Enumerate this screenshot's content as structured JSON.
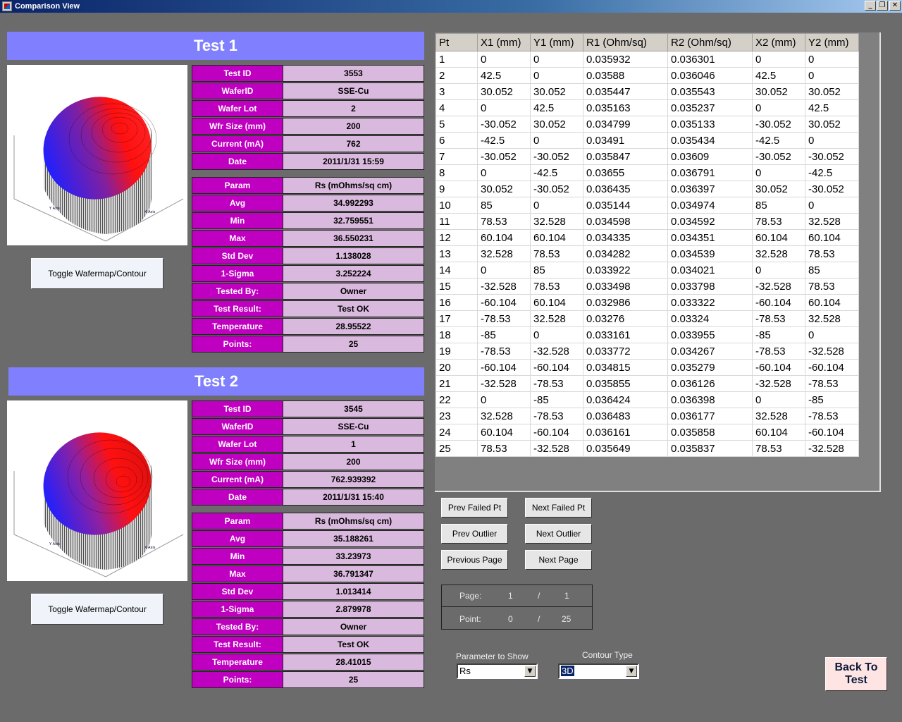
{
  "window": {
    "title": "Comparison View"
  },
  "test1": {
    "header": "Test 1",
    "toggle_label": "Toggle Wafermap/Contour",
    "info": [
      {
        "key": "Test ID",
        "value": "3553"
      },
      {
        "key": "WaferID",
        "value": "SSE-Cu"
      },
      {
        "key": "Wafer Lot",
        "value": "2"
      },
      {
        "key": "Wfr Size (mm)",
        "value": "200"
      },
      {
        "key": "Current (mA)",
        "value": "762"
      },
      {
        "key": "Date",
        "value": "2011/1/31 15:59"
      }
    ],
    "stats": [
      {
        "key": "Param",
        "value": "Rs (mOhms/sq cm)"
      },
      {
        "key": "Avg",
        "value": "34.992293"
      },
      {
        "key": "Min",
        "value": "32.759551"
      },
      {
        "key": "Max",
        "value": "36.550231"
      },
      {
        "key": "Std Dev",
        "value": "1.138028"
      },
      {
        "key": "1-Sigma",
        "value": "3.252224"
      },
      {
        "key": "Tested By:",
        "value": "Owner"
      },
      {
        "key": "Test Result:",
        "value": "Test OK"
      },
      {
        "key": "Temperature",
        "value": "28.95522"
      },
      {
        "key": "Points:",
        "value": "25"
      }
    ]
  },
  "test2": {
    "header": "Test 2",
    "toggle_label": "Toggle Wafermap/Contour",
    "info": [
      {
        "key": "Test ID",
        "value": "3545"
      },
      {
        "key": "WaferID",
        "value": "SSE-Cu"
      },
      {
        "key": "Wafer Lot",
        "value": "1"
      },
      {
        "key": "Wfr Size (mm)",
        "value": "200"
      },
      {
        "key": "Current (mA)",
        "value": "762.939392"
      },
      {
        "key": "Date",
        "value": "2011/1/31 15:40"
      }
    ],
    "stats": [
      {
        "key": "Param",
        "value": "Rs (mOhms/sq cm)"
      },
      {
        "key": "Avg",
        "value": "35.188261"
      },
      {
        "key": "Min",
        "value": "33.23973"
      },
      {
        "key": "Max",
        "value": "36.791347"
      },
      {
        "key": "Std Dev",
        "value": "1.013414"
      },
      {
        "key": "1-Sigma",
        "value": "2.879978"
      },
      {
        "key": "Tested By:",
        "value": "Owner"
      },
      {
        "key": "Test Result:",
        "value": "Test OK"
      },
      {
        "key": "Temperature",
        "value": "28.41015"
      },
      {
        "key": "Points:",
        "value": "25"
      }
    ]
  },
  "grid": {
    "columns": [
      "Pt",
      "X1 (mm)",
      "Y1 (mm)",
      "R1 (Ohm/sq)",
      "R2 (Ohm/sq)",
      "X2 (mm)",
      "Y2 (mm)"
    ],
    "rows": [
      [
        "1",
        "0",
        "0",
        "0.035932",
        "0.036301",
        "0",
        "0"
      ],
      [
        "2",
        "42.5",
        "0",
        "0.03588",
        "0.036046",
        "42.5",
        "0"
      ],
      [
        "3",
        "30.052",
        "30.052",
        "0.035447",
        "0.035543",
        "30.052",
        "30.052"
      ],
      [
        "4",
        "0",
        "42.5",
        "0.035163",
        "0.035237",
        "0",
        "42.5"
      ],
      [
        "5",
        "-30.052",
        "30.052",
        "0.034799",
        "0.035133",
        "-30.052",
        "30.052"
      ],
      [
        "6",
        "-42.5",
        "0",
        "0.03491",
        "0.035434",
        "-42.5",
        "0"
      ],
      [
        "7",
        "-30.052",
        "-30.052",
        "0.035847",
        "0.03609",
        "-30.052",
        "-30.052"
      ],
      [
        "8",
        "0",
        "-42.5",
        "0.03655",
        "0.036791",
        "0",
        "-42.5"
      ],
      [
        "9",
        "30.052",
        "-30.052",
        "0.036435",
        "0.036397",
        "30.052",
        "-30.052"
      ],
      [
        "10",
        "85",
        "0",
        "0.035144",
        "0.034974",
        "85",
        "0"
      ],
      [
        "11",
        "78.53",
        "32.528",
        "0.034598",
        "0.034592",
        "78.53",
        "32.528"
      ],
      [
        "12",
        "60.104",
        "60.104",
        "0.034335",
        "0.034351",
        "60.104",
        "60.104"
      ],
      [
        "13",
        "32.528",
        "78.53",
        "0.034282",
        "0.034539",
        "32.528",
        "78.53"
      ],
      [
        "14",
        "0",
        "85",
        "0.033922",
        "0.034021",
        "0",
        "85"
      ],
      [
        "15",
        "-32.528",
        "78.53",
        "0.033498",
        "0.033798",
        "-32.528",
        "78.53"
      ],
      [
        "16",
        "-60.104",
        "60.104",
        "0.032986",
        "0.033322",
        "-60.104",
        "60.104"
      ],
      [
        "17",
        "-78.53",
        "32.528",
        "0.03276",
        "0.03324",
        "-78.53",
        "32.528"
      ],
      [
        "18",
        "-85",
        "0",
        "0.033161",
        "0.033955",
        "-85",
        "0"
      ],
      [
        "19",
        "-78.53",
        "-32.528",
        "0.033772",
        "0.034267",
        "-78.53",
        "-32.528"
      ],
      [
        "20",
        "-60.104",
        "-60.104",
        "0.034815",
        "0.035279",
        "-60.104",
        "-60.104"
      ],
      [
        "21",
        "-32.528",
        "-78.53",
        "0.035855",
        "0.036126",
        "-32.528",
        "-78.53"
      ],
      [
        "22",
        "0",
        "-85",
        "0.036424",
        "0.036398",
        "0",
        "-85"
      ],
      [
        "23",
        "32.528",
        "-78.53",
        "0.036483",
        "0.036177",
        "32.528",
        "-78.53"
      ],
      [
        "24",
        "60.104",
        "-60.104",
        "0.036161",
        "0.035858",
        "60.104",
        "-60.104"
      ],
      [
        "25",
        "78.53",
        "-32.528",
        "0.035649",
        "0.035837",
        "78.53",
        "-32.528"
      ]
    ]
  },
  "nav": {
    "prev_failed": "Prev Failed Pt",
    "next_failed": "Next Failed Pt",
    "prev_outlier": "Prev Outlier",
    "next_outlier": "Next Outlier",
    "previous_page": "Previous Page",
    "next_page": "Next Page"
  },
  "pager": {
    "page_label": "Page:",
    "page_current": "1",
    "page_sep": "/",
    "page_total": "1",
    "point_label": "Point:",
    "point_current": "0",
    "point_sep": "/",
    "point_total": "25"
  },
  "controls": {
    "parameter_label": "Parameter to Show",
    "parameter_value": "Rs",
    "contour_label": "Contour Type",
    "contour_value": "3D"
  },
  "back_button": {
    "line1": "Back To",
    "line2": "Test"
  }
}
